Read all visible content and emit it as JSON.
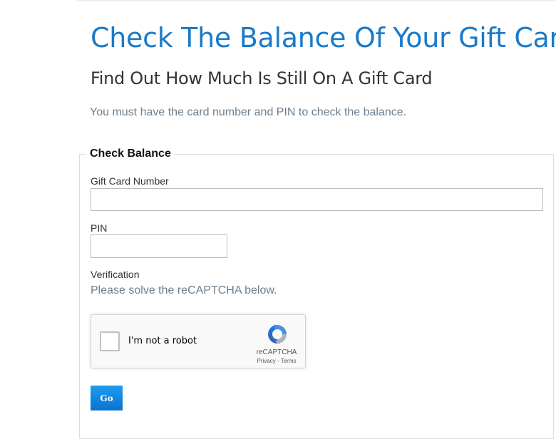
{
  "header": {
    "title": "Check The Balance Of Your Gift Card",
    "subtitle": "Find Out How Much Is Still On A Gift Card",
    "intro": "You must have the card number and PIN to check the balance."
  },
  "form": {
    "legend": "Check Balance",
    "card_number": {
      "label": "Gift Card Number",
      "value": "",
      "placeholder": ""
    },
    "pin": {
      "label": "PIN",
      "value": "",
      "placeholder": ""
    },
    "verification": {
      "label": "Verification",
      "hint": "Please solve the reCAPTCHA below."
    },
    "captcha": {
      "checkbox_label": "I'm not a robot",
      "brand": "reCAPTCHA",
      "privacy_link": "Privacy",
      "separator": "-",
      "terms_link": "Terms",
      "checked": false
    },
    "submit_label": "Go"
  },
  "colors": {
    "accent": "#1a7ac9",
    "muted_text": "#6b7f8e",
    "button_top": "#1f9cf0",
    "button_bottom": "#0b72cf"
  },
  "icons": {
    "captcha_logo": "recaptcha-logo-icon"
  }
}
